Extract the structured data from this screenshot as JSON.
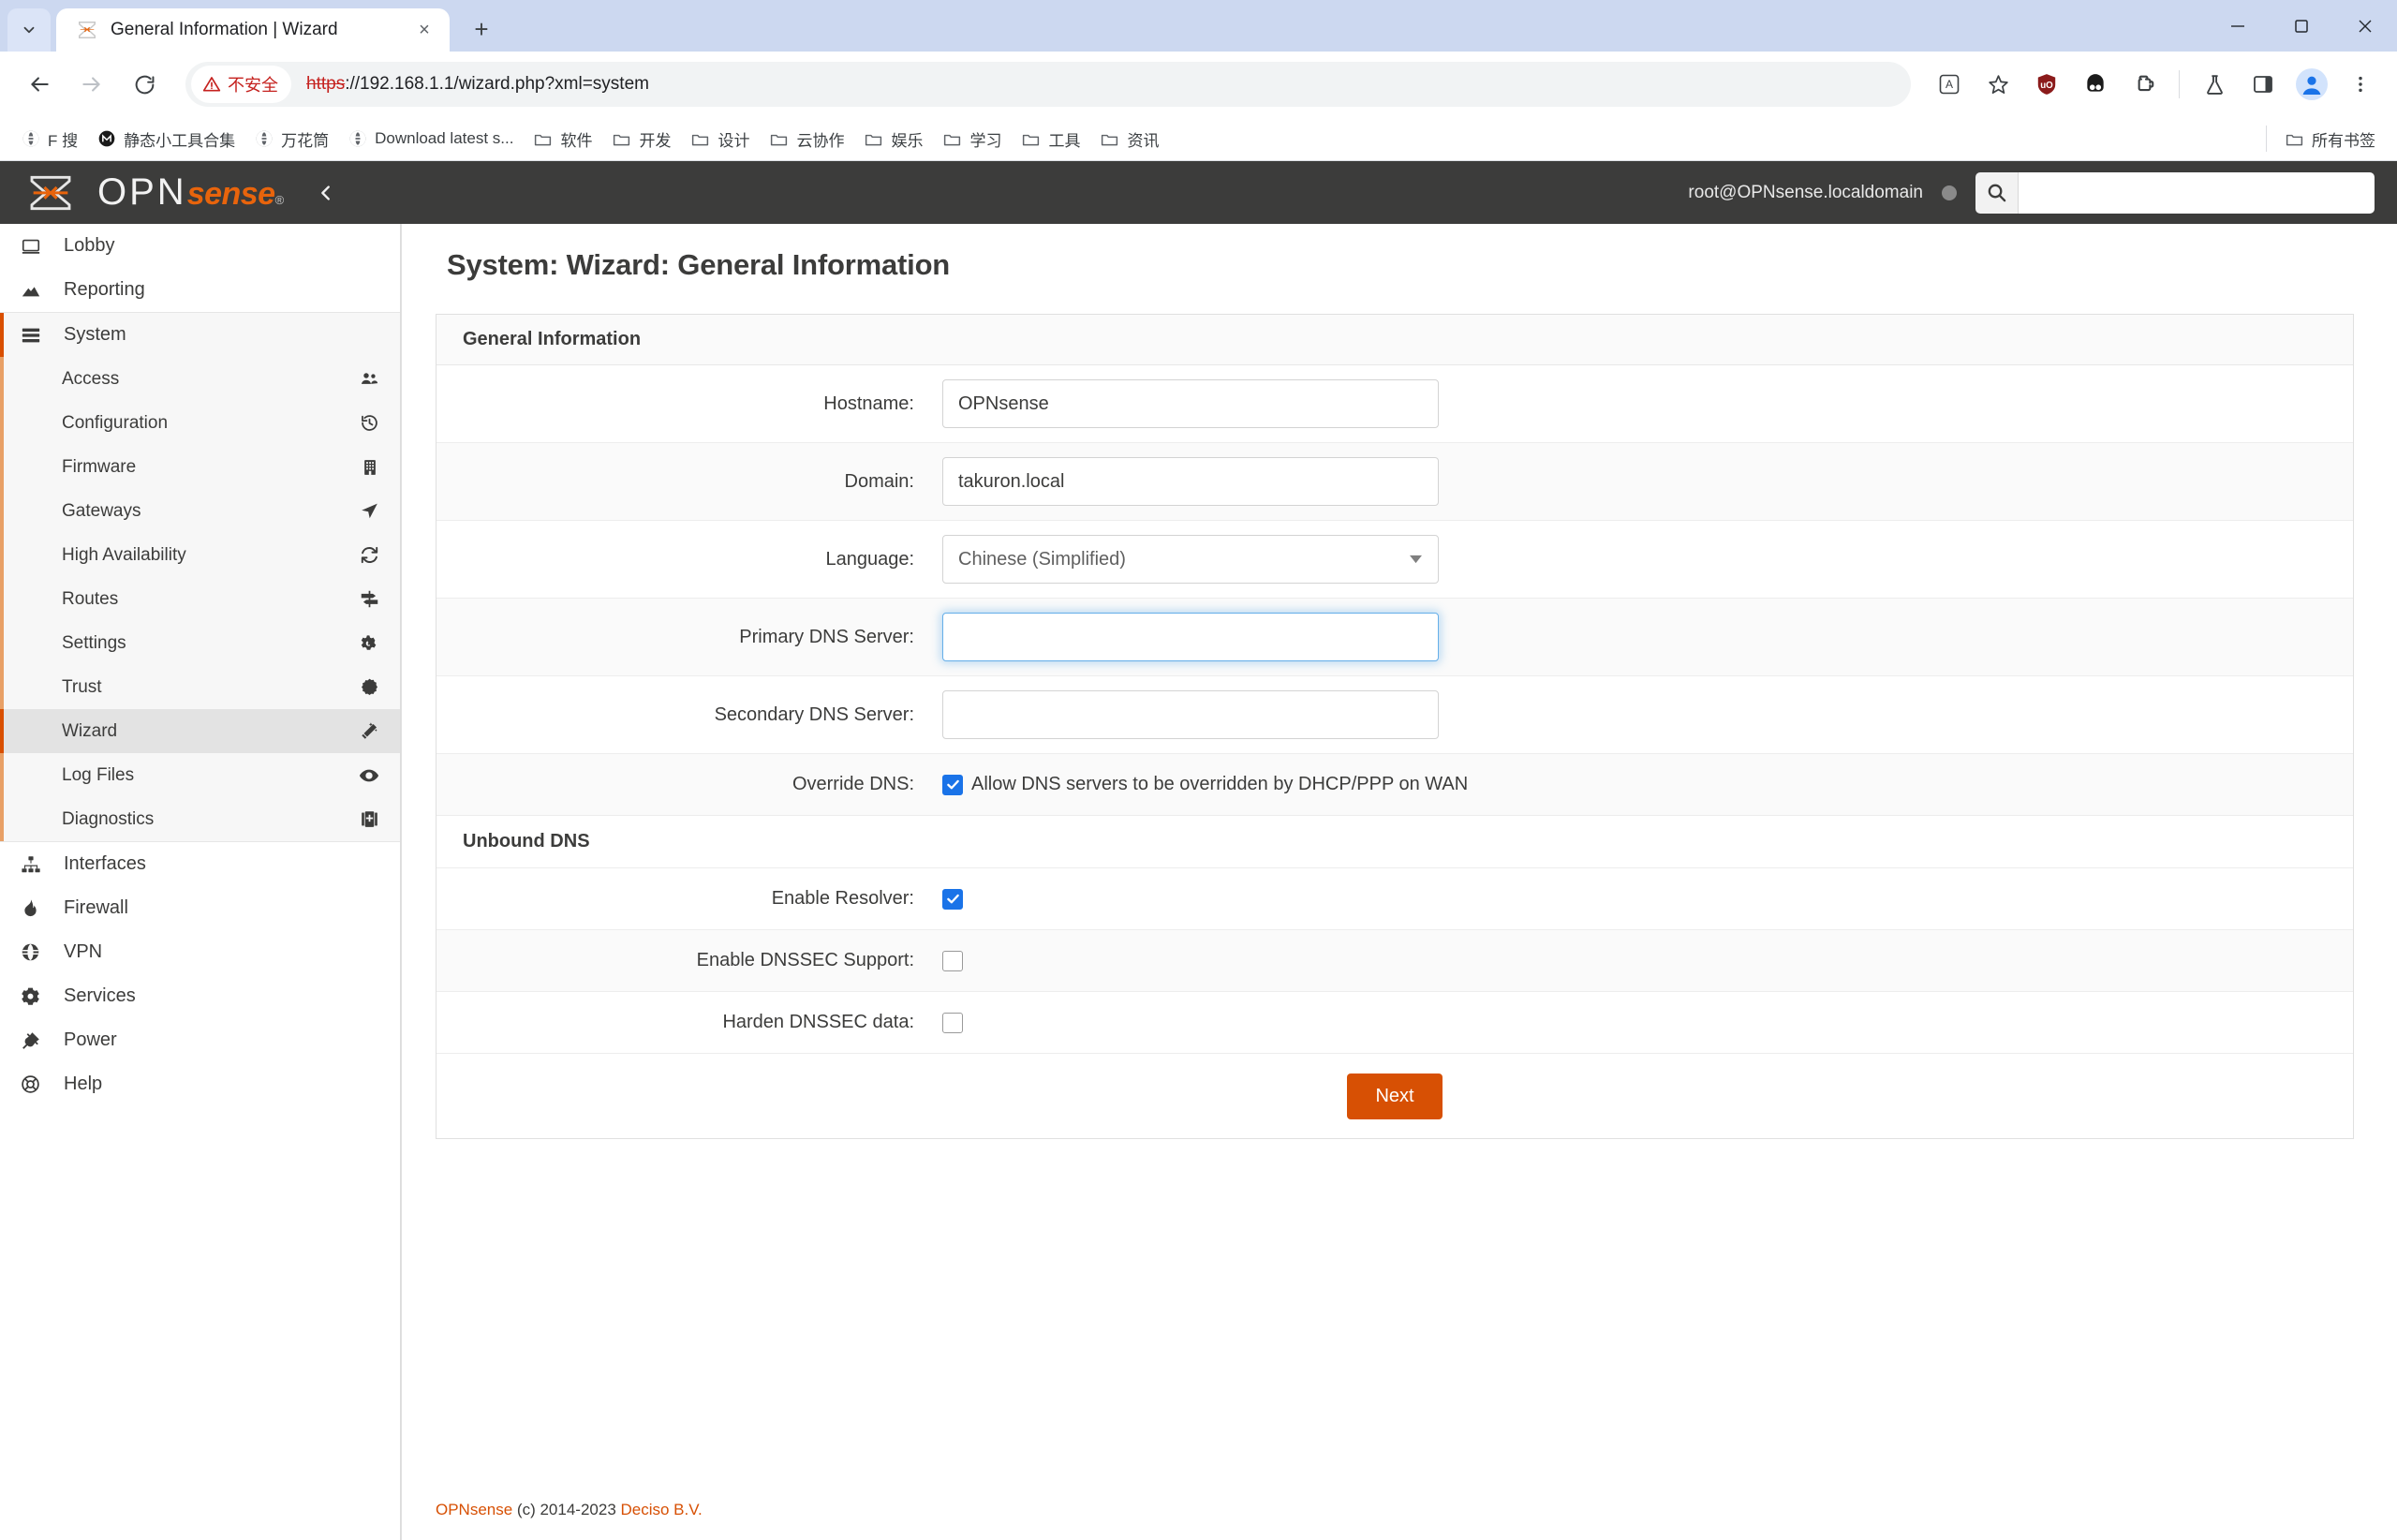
{
  "browser": {
    "tab": {
      "title": "General Information | Wizard",
      "favicon": "opnsense-icon",
      "close_label": "×"
    },
    "newtab_label": "+",
    "window_controls": {
      "minimize": "—",
      "maximize": "☐",
      "close": "×"
    },
    "nav": {
      "back": "←",
      "forward": "→",
      "reload": "↻"
    },
    "omnibox": {
      "security_label": "不安全",
      "url_scheme": "https",
      "url_rest": "://192.168.1.1/wizard.php?xml=system",
      "star_icon": "bookmark-star-icon"
    },
    "toolbar_icons": [
      {
        "name": "translate-icon",
        "glyph": "文"
      },
      {
        "name": "bookmark-star-icon",
        "glyph": "☆"
      },
      {
        "name": "ublock-extension-icon",
        "glyph": ""
      },
      {
        "name": "extension-dark-icon",
        "glyph": ""
      },
      {
        "name": "extensions-puzzle-icon",
        "glyph": ""
      },
      {
        "name": "labs-flask-icon",
        "glyph": ""
      },
      {
        "name": "side-panel-icon",
        "glyph": ""
      },
      {
        "name": "profile-avatar-icon",
        "glyph": ""
      },
      {
        "name": "chrome-menu-icon",
        "glyph": "⋮"
      }
    ],
    "bookmarks": [
      {
        "label": "F 搜",
        "icon": "globe-icon"
      },
      {
        "label": "静态小工具合集",
        "icon": "m-circle-icon"
      },
      {
        "label": "万花筒",
        "icon": "globe-icon"
      },
      {
        "label": "Download latest s...",
        "icon": "globe-icon"
      },
      {
        "label": "软件",
        "icon": "folder-icon"
      },
      {
        "label": "开发",
        "icon": "folder-icon"
      },
      {
        "label": "设计",
        "icon": "folder-icon"
      },
      {
        "label": "云协作",
        "icon": "folder-icon"
      },
      {
        "label": "娱乐",
        "icon": "folder-icon"
      },
      {
        "label": "学习",
        "icon": "folder-icon"
      },
      {
        "label": "工具",
        "icon": "folder-icon"
      },
      {
        "label": "资讯",
        "icon": "folder-icon"
      }
    ],
    "all_bookmarks": {
      "label": "所有书签",
      "icon": "folder-icon"
    }
  },
  "opnsense": {
    "brand": {
      "opn": "OPN",
      "sense": "sense",
      "reg": "®"
    },
    "collapse_icon": "chevron-left-icon",
    "user": "root@OPNsense.localdomain",
    "search_placeholder": "",
    "search_value": "",
    "sidebar": {
      "top": [
        {
          "label": "Lobby",
          "icon": "monitor-icon"
        },
        {
          "label": "Reporting",
          "icon": "chart-area-icon"
        }
      ],
      "group": {
        "label": "System",
        "icon": "server-stack-icon"
      },
      "sub": [
        {
          "label": "Access",
          "icon": "users-icon",
          "active": false
        },
        {
          "label": "Configuration",
          "icon": "history-icon",
          "active": false
        },
        {
          "label": "Firmware",
          "icon": "building-icon",
          "active": false
        },
        {
          "label": "Gateways",
          "icon": "navigation-arrow-icon",
          "active": false
        },
        {
          "label": "High Availability",
          "icon": "sync-icon",
          "active": false
        },
        {
          "label": "Routes",
          "icon": "signpost-icon",
          "active": false
        },
        {
          "label": "Settings",
          "icon": "gears-icon",
          "active": false
        },
        {
          "label": "Trust",
          "icon": "certificate-icon",
          "active": false
        },
        {
          "label": "Wizard",
          "icon": "magic-wand-icon",
          "active": true
        },
        {
          "label": "Log Files",
          "icon": "eye-icon",
          "active": false
        },
        {
          "label": "Diagnostics",
          "icon": "medical-kit-icon",
          "active": false
        }
      ],
      "bottom": [
        {
          "label": "Interfaces",
          "icon": "sitemap-icon"
        },
        {
          "label": "Firewall",
          "icon": "fire-icon"
        },
        {
          "label": "VPN",
          "icon": "globe-icon"
        },
        {
          "label": "Services",
          "icon": "gear-icon"
        },
        {
          "label": "Power",
          "icon": "power-plug-icon"
        },
        {
          "label": "Help",
          "icon": "lifebuoy-icon"
        }
      ]
    },
    "main": {
      "page_title": "System: Wizard: General Information",
      "card_title": "General Information",
      "fields": {
        "hostname": {
          "label": "Hostname:",
          "value": "OPNsense",
          "placeholder": ""
        },
        "domain": {
          "label": "Domain:",
          "value": "takuron.local",
          "placeholder": ""
        },
        "language": {
          "label": "Language:",
          "value": "Chinese (Simplified)"
        },
        "primary_dns": {
          "label": "Primary DNS Server:",
          "value": "",
          "placeholder": ""
        },
        "secondary_dns": {
          "label": "Secondary DNS Server:",
          "value": "",
          "placeholder": ""
        },
        "override_dns": {
          "label": "Override DNS:",
          "checkbox_label": "Allow DNS servers to be overridden by DHCP/PPP on WAN",
          "checked": true
        }
      },
      "unbound": {
        "section_title": "Unbound DNS",
        "enable_resolver": {
          "label": "Enable Resolver:",
          "checked": true
        },
        "enable_dnssec": {
          "label": "Enable DNSSEC Support:",
          "checked": false
        },
        "harden_dnssec": {
          "label": "Harden DNSSEC data:",
          "checked": false
        }
      },
      "next_button": "Next",
      "footer": {
        "brand": "OPNsense",
        "copyright": " (c) 2014-2023 ",
        "company": "Deciso B.V."
      }
    },
    "colors": {
      "accent": "#d75004",
      "header_bg": "#3c3c3b",
      "active_bg": "#e3e3e3",
      "checkbox_blue": "#1a73e8"
    }
  }
}
